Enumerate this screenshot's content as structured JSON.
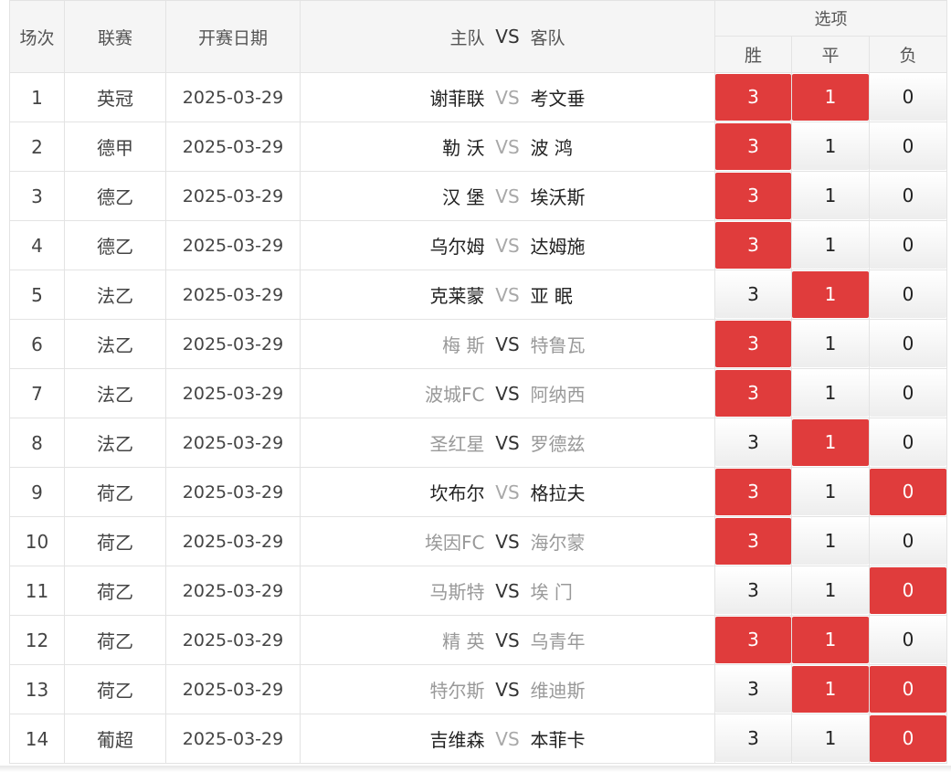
{
  "headers": {
    "round": "场次",
    "league": "联赛",
    "date": "开赛日期",
    "home": "主队",
    "vs": "VS",
    "away": "客队",
    "options": "选项",
    "win": "胜",
    "draw": "平",
    "lose": "负"
  },
  "colors": {
    "selected": "#e03c3c",
    "header_bg": "#f5f5f5",
    "dim_text": "#999999"
  },
  "rows": [
    {
      "no": "1",
      "league": "英冠",
      "date": "2025-03-29",
      "home": "谢菲联",
      "away": "考文垂",
      "vs": "VS",
      "home_dim": false,
      "away_dim": false,
      "vs_dim": true,
      "win": "3",
      "draw": "1",
      "lose": "0",
      "sel_win": true,
      "sel_draw": true,
      "sel_lose": false
    },
    {
      "no": "2",
      "league": "德甲",
      "date": "2025-03-29",
      "home": "勒 沃",
      "away": "波 鸿",
      "vs": "VS",
      "home_dim": false,
      "away_dim": false,
      "vs_dim": true,
      "win": "3",
      "draw": "1",
      "lose": "0",
      "sel_win": true,
      "sel_draw": false,
      "sel_lose": false
    },
    {
      "no": "3",
      "league": "德乙",
      "date": "2025-03-29",
      "home": "汉 堡",
      "away": "埃沃斯",
      "vs": "VS",
      "home_dim": false,
      "away_dim": false,
      "vs_dim": true,
      "win": "3",
      "draw": "1",
      "lose": "0",
      "sel_win": true,
      "sel_draw": false,
      "sel_lose": false
    },
    {
      "no": "4",
      "league": "德乙",
      "date": "2025-03-29",
      "home": "乌尔姆",
      "away": "达姆施",
      "vs": "VS",
      "home_dim": false,
      "away_dim": false,
      "vs_dim": true,
      "win": "3",
      "draw": "1",
      "lose": "0",
      "sel_win": true,
      "sel_draw": false,
      "sel_lose": false
    },
    {
      "no": "5",
      "league": "法乙",
      "date": "2025-03-29",
      "home": "克莱蒙",
      "away": "亚 眠",
      "vs": "VS",
      "home_dim": false,
      "away_dim": false,
      "vs_dim": true,
      "win": "3",
      "draw": "1",
      "lose": "0",
      "sel_win": false,
      "sel_draw": true,
      "sel_lose": false
    },
    {
      "no": "6",
      "league": "法乙",
      "date": "2025-03-29",
      "home": "梅 斯",
      "away": "特鲁瓦",
      "vs": "VS",
      "home_dim": true,
      "away_dim": true,
      "vs_dim": false,
      "win": "3",
      "draw": "1",
      "lose": "0",
      "sel_win": true,
      "sel_draw": false,
      "sel_lose": false
    },
    {
      "no": "7",
      "league": "法乙",
      "date": "2025-03-29",
      "home": "波城FC",
      "away": "阿纳西",
      "vs": "VS",
      "home_dim": true,
      "away_dim": true,
      "vs_dim": false,
      "win": "3",
      "draw": "1",
      "lose": "0",
      "sel_win": true,
      "sel_draw": false,
      "sel_lose": false
    },
    {
      "no": "8",
      "league": "法乙",
      "date": "2025-03-29",
      "home": "圣红星",
      "away": "罗德兹",
      "vs": "VS",
      "home_dim": true,
      "away_dim": true,
      "vs_dim": false,
      "win": "3",
      "draw": "1",
      "lose": "0",
      "sel_win": false,
      "sel_draw": true,
      "sel_lose": false
    },
    {
      "no": "9",
      "league": "荷乙",
      "date": "2025-03-29",
      "home": "坎布尔",
      "away": "格拉夫",
      "vs": "VS",
      "home_dim": false,
      "away_dim": false,
      "vs_dim": true,
      "win": "3",
      "draw": "1",
      "lose": "0",
      "sel_win": true,
      "sel_draw": false,
      "sel_lose": true
    },
    {
      "no": "10",
      "league": "荷乙",
      "date": "2025-03-29",
      "home": "埃因FC",
      "away": "海尔蒙",
      "vs": "VS",
      "home_dim": true,
      "away_dim": true,
      "vs_dim": false,
      "win": "3",
      "draw": "1",
      "lose": "0",
      "sel_win": true,
      "sel_draw": false,
      "sel_lose": false
    },
    {
      "no": "11",
      "league": "荷乙",
      "date": "2025-03-29",
      "home": "马斯特",
      "away": "埃 门",
      "vs": "VS",
      "home_dim": true,
      "away_dim": true,
      "vs_dim": false,
      "win": "3",
      "draw": "1",
      "lose": "0",
      "sel_win": false,
      "sel_draw": false,
      "sel_lose": true
    },
    {
      "no": "12",
      "league": "荷乙",
      "date": "2025-03-29",
      "home": "精 英",
      "away": "乌青年",
      "vs": "VS",
      "home_dim": true,
      "away_dim": true,
      "vs_dim": false,
      "win": "3",
      "draw": "1",
      "lose": "0",
      "sel_win": true,
      "sel_draw": true,
      "sel_lose": false
    },
    {
      "no": "13",
      "league": "荷乙",
      "date": "2025-03-29",
      "home": "特尔斯",
      "away": "维迪斯",
      "vs": "VS",
      "home_dim": true,
      "away_dim": true,
      "vs_dim": false,
      "win": "3",
      "draw": "1",
      "lose": "0",
      "sel_win": false,
      "sel_draw": true,
      "sel_lose": true
    },
    {
      "no": "14",
      "league": "葡超",
      "date": "2025-03-29",
      "home": "吉维森",
      "away": "本菲卡",
      "vs": "VS",
      "home_dim": false,
      "away_dim": false,
      "vs_dim": true,
      "win": "3",
      "draw": "1",
      "lose": "0",
      "sel_win": false,
      "sel_draw": false,
      "sel_lose": true
    }
  ]
}
